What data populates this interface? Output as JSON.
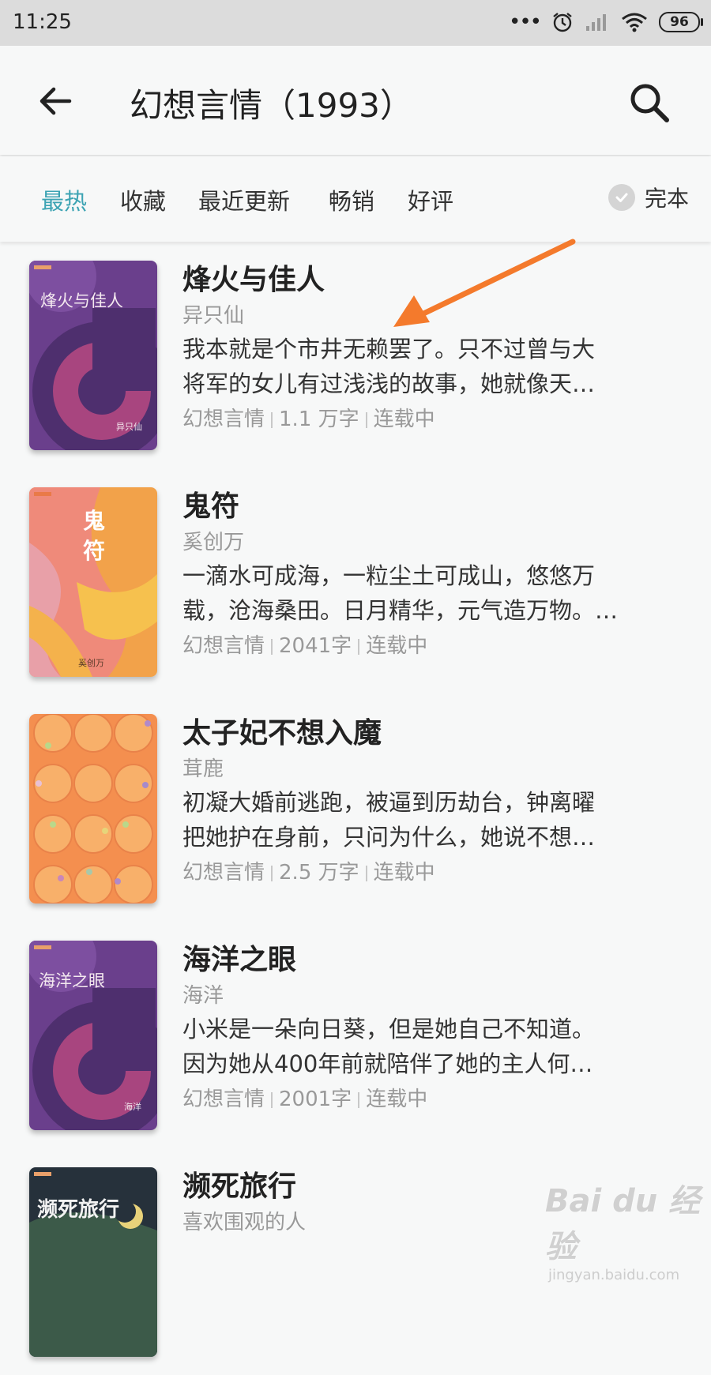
{
  "status_bar": {
    "time": "11:25",
    "battery": "96"
  },
  "header": {
    "title": "幻想言情（1993）"
  },
  "filters": {
    "tabs": [
      "最热",
      "收藏",
      "最近更新",
      "畅销",
      "好评"
    ],
    "active_tab": "最热",
    "complete_label": "完本"
  },
  "books": [
    {
      "title": "烽火与佳人",
      "cover_title": "烽火与佳人",
      "cover_author": "异只仙",
      "author": "异只仙",
      "description_line1": "我本就是个市井无赖罢了。只不过曾与大",
      "description_line2": "将军的女儿有过浅浅的故事，她就像天…",
      "category": "幻想言情",
      "words": "1.1 万字",
      "status": "连载中"
    },
    {
      "title": "鬼符",
      "cover_title": "鬼符",
      "cover_author": "奚创万",
      "author": "奚创万",
      "description_line1": "一滴水可成海，一粒尘土可成山，悠悠万",
      "description_line2": "载，沧海桑田。日月精华，元气造万物。…",
      "category": "幻想言情",
      "words": "2041字",
      "status": "连载中"
    },
    {
      "title": "太子妃不想入魔",
      "author": "茸鹿",
      "description_line1": "初凝大婚前逃跑，被逼到历劫台，钟离曜",
      "description_line2": "把她护在身前，只问为什么，她说不想…",
      "category": "幻想言情",
      "words": "2.5 万字",
      "status": "连载中"
    },
    {
      "title": "海洋之眼",
      "cover_title": "海洋之眼",
      "cover_author": "海洋",
      "author": "海洋",
      "description_line1": "小米是一朵向日葵，但是她自己不知道。",
      "description_line2": "因为她从400年前就陪伴了她的主人何…",
      "category": "幻想言情",
      "words": "2001字",
      "status": "连载中"
    },
    {
      "title": "濒死旅行",
      "cover_title": "濒死旅行",
      "author": "喜欢围观的人"
    }
  ],
  "watermark": {
    "logo": "Bai du 经验",
    "url": "jingyan.baidu.com"
  },
  "colors": {
    "accent": "#3ca3b3",
    "annotation_arrow": "#f47a2c"
  }
}
